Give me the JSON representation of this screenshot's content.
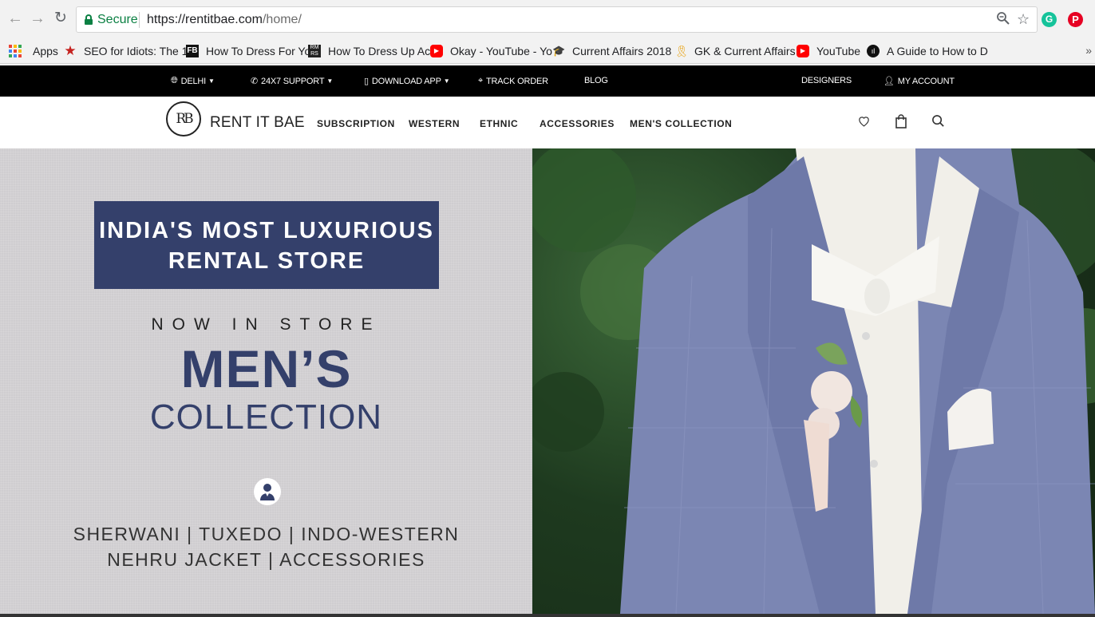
{
  "browser": {
    "secure_label": "Secure",
    "url_host": "https://rentitbae.com",
    "url_path": "/home/",
    "bookmarks": [
      {
        "label": "Apps",
        "icon": "apps-grid-icon"
      },
      {
        "label": "SEO for Idiots: The 1",
        "icon": "star-icon",
        "color": "#c5221f"
      },
      {
        "label": "How To Dress For Yo",
        "icon": "fb-icon"
      },
      {
        "label": "How To Dress Up Ac",
        "icon": "rmrs-icon"
      },
      {
        "label": "Okay - YouTube - Yo",
        "icon": "youtube-icon",
        "color": "#ff0000"
      },
      {
        "label": "Current Affairs 2018",
        "icon": "graduation-cap-icon"
      },
      {
        "label": "GK & Current Affairs",
        "icon": "award-ribbon-icon"
      },
      {
        "label": "YouTube",
        "icon": "youtube-icon",
        "color": "#ff0000"
      },
      {
        "label": "A Guide to How to D",
        "icon": "bars-circle-icon"
      }
    ],
    "more": "»"
  },
  "topbar": {
    "location": "DELHI",
    "support": "24X7 SUPPORT",
    "download": "DOWNLOAD APP",
    "track": "TRACK ORDER",
    "blog": "BLOG",
    "designers": "DESIGNERS",
    "account": "MY ACCOUNT"
  },
  "nav": {
    "logo_mark": "RB",
    "logo_text": "RENT IT BAE",
    "links": [
      "SUBSCRIPTION",
      "WESTERN",
      "ETHNIC",
      "ACCESSORIES",
      "MEN'S COLLECTION"
    ]
  },
  "hero": {
    "banner_line1": "INDIA'S MOST LUXURIOUS",
    "banner_line2": "RENTAL STORE",
    "now_in_store": "NOW IN STORE",
    "mens": "MEN’S",
    "collection": "COLLECTION",
    "categories_line1": "SHERWANI | TUXEDO | INDO-WESTERN",
    "categories_line2": "NEHRU JACKET | ACCESSORIES"
  },
  "colors": {
    "brand_navy": "#34406b",
    "secure_green": "#0b8043",
    "topbar_bg": "#000000"
  }
}
